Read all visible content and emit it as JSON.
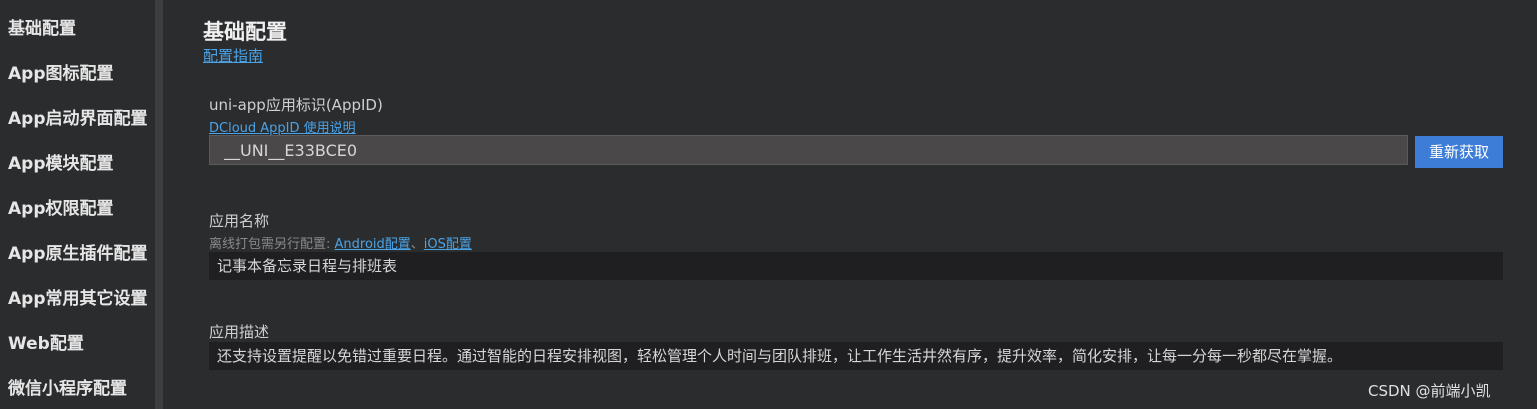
{
  "sidebar": {
    "items": [
      {
        "label": "基础配置"
      },
      {
        "label": "App图标配置"
      },
      {
        "label": "App启动界面配置"
      },
      {
        "label": "App模块配置"
      },
      {
        "label": "App权限配置"
      },
      {
        "label": "App原生插件配置"
      },
      {
        "label": "App常用其它设置"
      },
      {
        "label": "Web配置"
      },
      {
        "label": "微信小程序配置"
      }
    ]
  },
  "main": {
    "title": "基础配置",
    "guide_link": "配置指南",
    "appid": {
      "label": "uni-app应用标识(AppID)",
      "help_link": "DCloud AppID 使用说明",
      "value": "__UNI__E33BCE0",
      "refresh_label": "重新获取"
    },
    "app_name": {
      "label": "应用名称",
      "hint_prefix": "离线打包需另行配置: ",
      "android_link": "Android配置",
      "separator": "、",
      "ios_link": "iOS配置",
      "value": "记事本备忘录日程与排班表"
    },
    "app_desc": {
      "label": "应用描述",
      "value": "还支持设置提醒以免错过重要日程。通过智能的日程安排视图，轻松管理个人时间与团队排班，让工作生活井然有序，提升效率，简化安排，让每一分每一秒都尽在掌握。"
    }
  },
  "watermark": "CSDN @前端小凯",
  "colors": {
    "background": "#2b2c2e",
    "accent": "#3d7dd8",
    "link": "#4aa3e8"
  }
}
